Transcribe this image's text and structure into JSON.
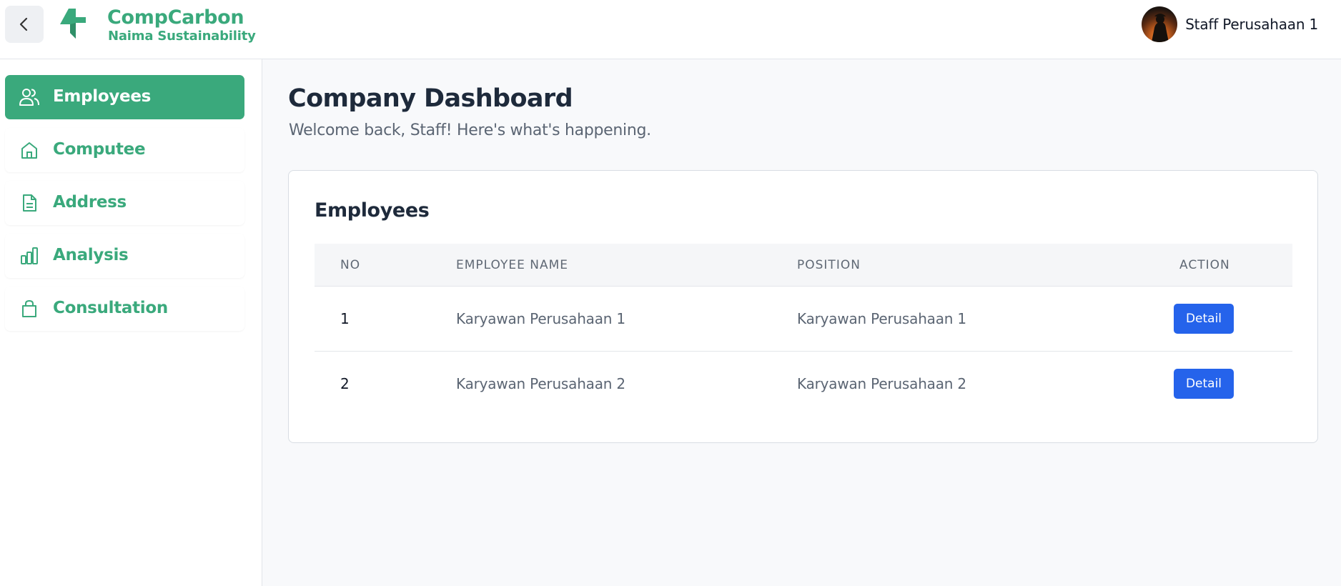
{
  "header": {
    "brand_name": "CompCarbon",
    "brand_sub": "Naima Sustainability",
    "user_name": "Staff Perusahaan 1",
    "back_icon": "chevron-left-icon",
    "logo_icon": "compcarbon-logo"
  },
  "sidebar": {
    "items": [
      {
        "label": "Employees",
        "icon": "users-icon",
        "active": true
      },
      {
        "label": "Computee",
        "icon": "home-icon",
        "active": false
      },
      {
        "label": "Address",
        "icon": "document-icon",
        "active": false
      },
      {
        "label": "Analysis",
        "icon": "bar-chart-icon",
        "active": false
      },
      {
        "label": "Consultation",
        "icon": "shopping-bag-icon",
        "active": false
      }
    ]
  },
  "main": {
    "title": "Company Dashboard",
    "subtitle": "Welcome back, Staff! Here's what's happening.",
    "card": {
      "title": "Employees",
      "columns": [
        "NO",
        "EMPLOYEE NAME",
        "POSITION",
        "ACTION"
      ],
      "rows": [
        {
          "no": "1",
          "name": "Karyawan Perusahaan 1",
          "position": "Karyawan Perusahaan 1",
          "action": "Detail"
        },
        {
          "no": "2",
          "name": "Karyawan Perusahaan 2",
          "position": "Karyawan Perusahaan 2",
          "action": "Detail"
        }
      ]
    }
  },
  "colors": {
    "brand_green": "#3aa97c",
    "action_blue": "#2563eb",
    "heading": "#1e2a3b"
  }
}
